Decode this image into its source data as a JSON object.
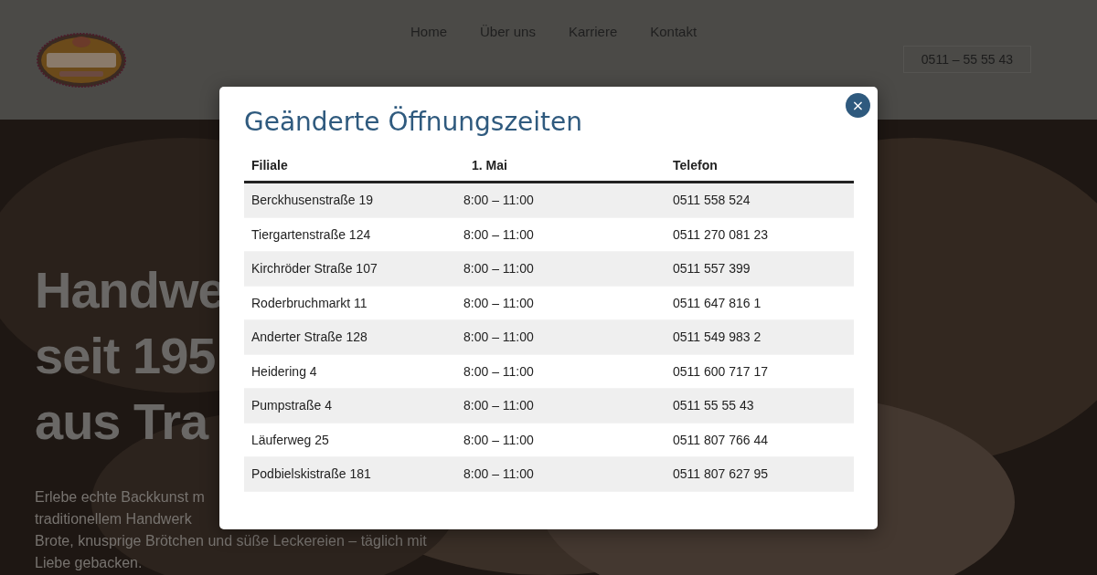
{
  "header": {
    "nav": [
      {
        "label": "Home"
      },
      {
        "label": "Über uns"
      },
      {
        "label": "Karriere"
      },
      {
        "label": "Kontakt"
      }
    ],
    "phone": "0511 – 55 55 43"
  },
  "hero": {
    "heading_lines": [
      "Handwe",
      "seit 195",
      "aus Tra"
    ],
    "text_lines": [
      "Erlebe echte Backkunst m",
      "traditionellem Handwerk",
      "Brote, knusprige Brötchen und süße Leckereien – täglich mit",
      "Liebe gebacken."
    ]
  },
  "modal": {
    "title": "Geänderte Öffnungszeiten",
    "close": "×",
    "table": {
      "columns": [
        "Filiale",
        "1. Mai",
        "Telefon"
      ],
      "rows": [
        [
          "Berckhusenstraße 19",
          "8:00 – 11:00",
          "0511 558 524"
        ],
        [
          "Tiergartenstraße 124",
          "8:00 – 11:00",
          "0511 270 081 23"
        ],
        [
          "Kirchröder Straße 107",
          "8:00 – 11:00",
          "0511 557 399"
        ],
        [
          "Roderbruchmarkt 11",
          "8:00 – 11:00",
          "0511 647 816 1"
        ],
        [
          "Anderter Straße 128",
          "8:00 – 11:00",
          "0511 549 983 2"
        ],
        [
          "Heidering 4",
          "8:00 – 11:00",
          "0511 600 717 17"
        ],
        [
          "Pumpstraße 4",
          "8:00 – 11:00",
          "0511 55 55 43"
        ],
        [
          "Läuferweg 25",
          "8:00 – 11:00",
          "0511 807 766 44"
        ],
        [
          "Podbielskistraße 181",
          "8:00 – 11:00",
          "0511 807 627 95"
        ]
      ]
    }
  }
}
